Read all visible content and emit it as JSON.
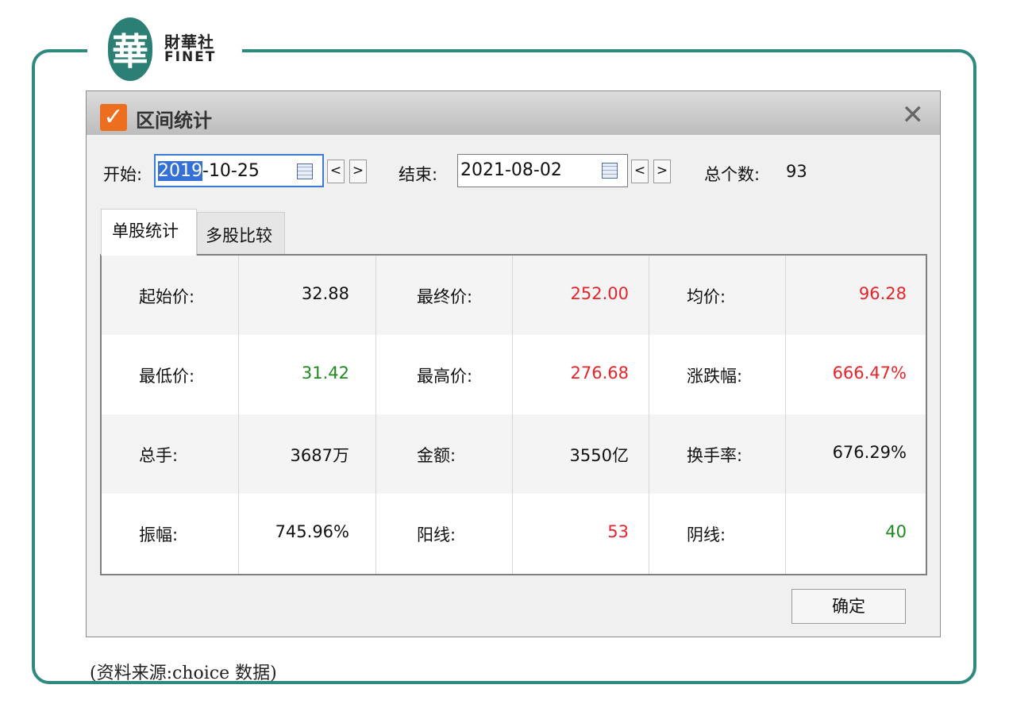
{
  "brand": {
    "logo_glyph": "華",
    "name_cn": "財華社",
    "name_en": "FINET"
  },
  "dialog": {
    "title": "区间统计",
    "close_glyph": "✕",
    "start_label": "开始:",
    "start_date_selected": "2019",
    "start_date_rest": "-10-25",
    "end_label": "结束:",
    "end_date": "2021-08-02",
    "prev": "<",
    "next": ">",
    "count_label": "总个数:",
    "count_value": "93",
    "tabs": {
      "single": "单股统计",
      "multi": "多股比较"
    },
    "ok_label": "确定"
  },
  "stats": {
    "r0": {
      "l1": "起始价:",
      "v1": "32.88",
      "l2": "最终价:",
      "v2": "252.00",
      "l3": "均价:",
      "v3": "96.28"
    },
    "r1": {
      "l1": "最低价:",
      "v1": "31.42",
      "l2": "最高价:",
      "v2": "276.68",
      "l3": "涨跌幅:",
      "v3": "666.47%"
    },
    "r2": {
      "l1": "总手:",
      "v1": "3687万",
      "l2": "金额:",
      "v2": "3550亿",
      "l3": "换手率:",
      "v3": "676.29%"
    },
    "r3": {
      "l1": "振幅:",
      "v1": "745.96%",
      "l2": "阳线:",
      "v2": "53",
      "l3": "阴线:",
      "v3": "40"
    }
  },
  "colors": {
    "up": "#e8242b",
    "down": "#1f8a1f",
    "neutral": "#111111",
    "brand": "#2c7f74",
    "accent": "#ee6e1f"
  },
  "source_note": "(资料来源:choice 数据)"
}
